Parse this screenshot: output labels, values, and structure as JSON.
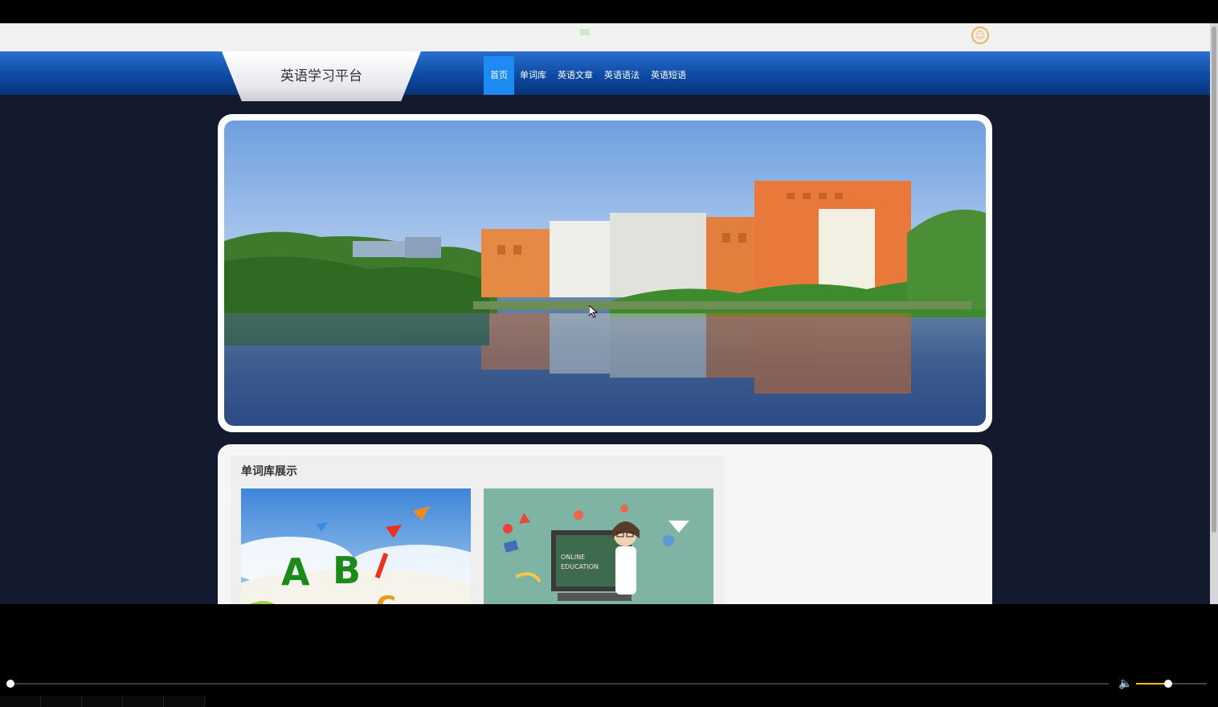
{
  "site": {
    "title": "英语学习平台"
  },
  "nav": {
    "items": [
      {
        "label": "首页",
        "active": true
      },
      {
        "label": "单词库",
        "active": false
      },
      {
        "label": "英语文章",
        "active": false
      },
      {
        "label": "英语语法",
        "active": false
      },
      {
        "label": "英语短语",
        "active": false
      }
    ]
  },
  "section": {
    "title": "单词库展示"
  },
  "thumbnails": {
    "abc": {
      "letters": [
        "A",
        "B",
        "C"
      ]
    },
    "online": {
      "line1": "ONLINE",
      "line2": "EDUCATION"
    }
  },
  "icons": {
    "user": "user-avatar-icon",
    "volume": "volume-icon"
  },
  "colors": {
    "page_bg": "#131a2e",
    "nav_blue": "#0d4aa3",
    "nav_active": "#1e8bf5",
    "volume_accent": "#f5c000"
  },
  "player": {
    "progress": 0.0,
    "volume": 0.45
  }
}
